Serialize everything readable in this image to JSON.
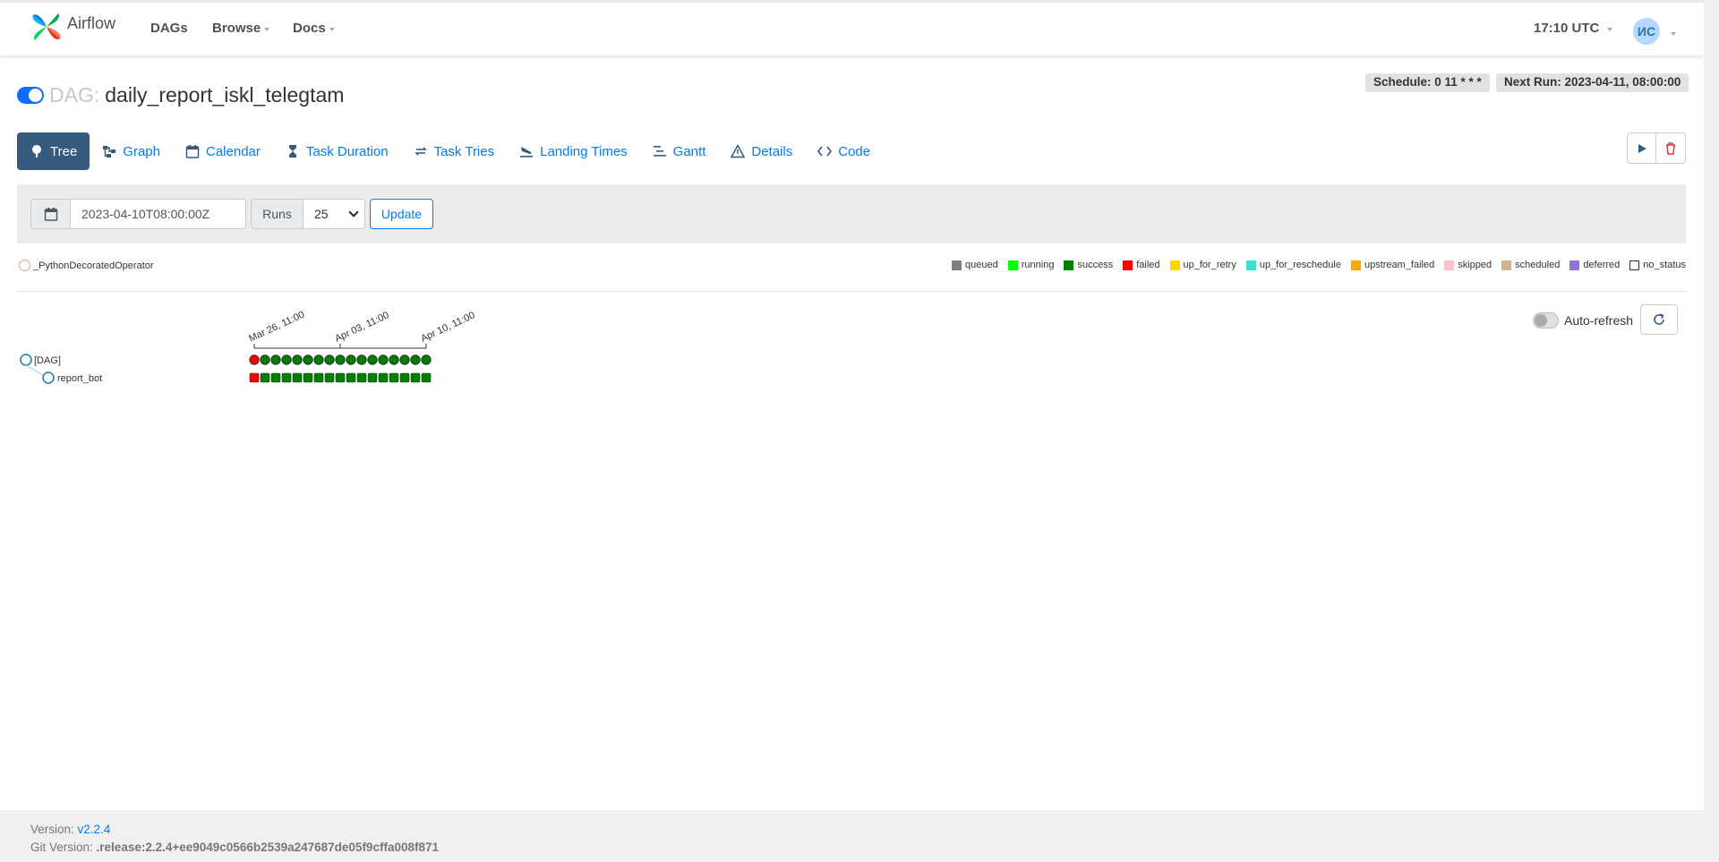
{
  "navbar": {
    "brand": "Airflow",
    "items": [
      {
        "label": "DAGs"
      },
      {
        "label": "Browse"
      },
      {
        "label": "Docs"
      }
    ],
    "clock": "17:10 UTC",
    "avatar_initials": "ИС"
  },
  "dag": {
    "prefix": "DAG:",
    "name": "daily_report_iskl_telegtam",
    "paused": false,
    "schedule_label": "Schedule: 0 11 * * *",
    "next_run_label": "Next Run: 2023-04-11, 08:00:00"
  },
  "tabs": [
    {
      "label": "Tree",
      "icon": "tree-icon",
      "active": true
    },
    {
      "label": "Graph",
      "icon": "graph-icon"
    },
    {
      "label": "Calendar",
      "icon": "calendar-icon"
    },
    {
      "label": "Task Duration",
      "icon": "hourglass-icon"
    },
    {
      "label": "Task Tries",
      "icon": "retry-icon"
    },
    {
      "label": "Landing Times",
      "icon": "plane-landing-icon"
    },
    {
      "label": "Gantt",
      "icon": "gantt-icon"
    },
    {
      "label": "Details",
      "icon": "warning-triangle-icon"
    },
    {
      "label": "Code",
      "icon": "code-icon"
    }
  ],
  "actions": {
    "trigger_icon": "play-icon",
    "delete_icon": "trash-icon",
    "trash_color": "#dc3545"
  },
  "filters": {
    "base_date": "2023-04-10T08:00:00Z",
    "runs_label": "Runs",
    "runs_value": "25",
    "update_label": "Update"
  },
  "operator": {
    "label": "_PythonDecoratedOperator"
  },
  "legend": [
    {
      "label": "queued",
      "color": "#808080"
    },
    {
      "label": "running",
      "color": "#00ff00"
    },
    {
      "label": "success",
      "color": "#008000"
    },
    {
      "label": "failed",
      "color": "#ff0000"
    },
    {
      "label": "up_for_retry",
      "color": "#ffd700"
    },
    {
      "label": "up_for_reschedule",
      "color": "#40e0d0"
    },
    {
      "label": "upstream_failed",
      "color": "#ffa500"
    },
    {
      "label": "skipped",
      "color": "#ffc0cb"
    },
    {
      "label": "scheduled",
      "color": "#d2b48c"
    },
    {
      "label": "deferred",
      "color": "#9370db"
    },
    {
      "label": "no_status",
      "color": "#ffffff"
    }
  ],
  "tree": {
    "date_labels": [
      "Mar 26, 11:00",
      "Apr 03, 11:00",
      "Apr 10, 11:00"
    ],
    "dag_node": "[DAG]",
    "task_node": "report_bot",
    "run_states": [
      "failed",
      "success",
      "success",
      "success",
      "success",
      "success",
      "success",
      "success",
      "success",
      "success",
      "success",
      "success",
      "success",
      "success",
      "success",
      "success",
      "success"
    ],
    "task_states": [
      "failed",
      "success",
      "success",
      "success",
      "success",
      "success",
      "success",
      "success",
      "success",
      "success",
      "success",
      "success",
      "success",
      "success",
      "success",
      "success",
      "success"
    ]
  },
  "auto_refresh": {
    "label": "Auto-refresh",
    "enabled": false
  },
  "footer": {
    "version_prefix": "Version:",
    "version": "v2.2.4",
    "git_prefix": "Git Version:",
    "git_version": ".release:2.2.4+ee9049c0566b2539a247687de05f9cffa008f871"
  }
}
